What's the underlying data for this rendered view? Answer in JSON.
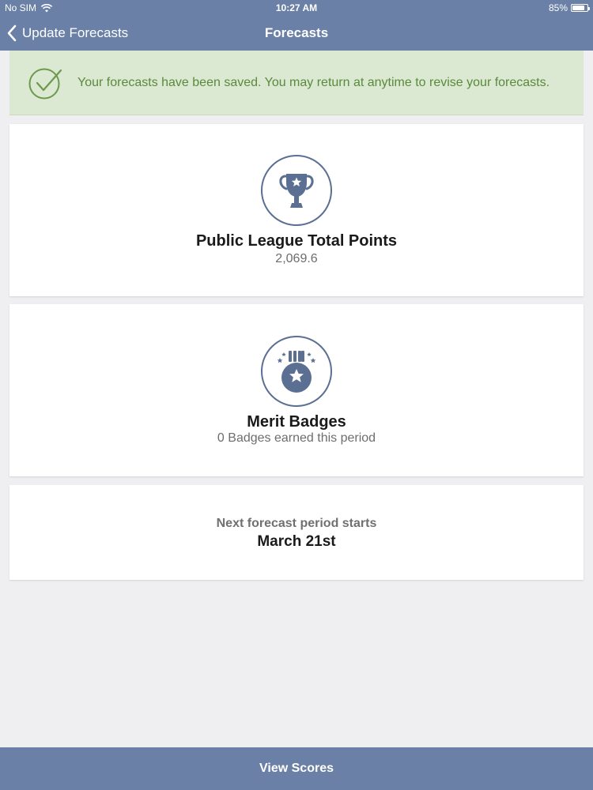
{
  "status_bar": {
    "carrier": "No SIM",
    "time": "10:27 AM",
    "battery": "85%",
    "battery_level": 0.85
  },
  "nav": {
    "back_label": "Update Forecasts",
    "title": "Forecasts"
  },
  "alert": {
    "message": "Your forecasts have been saved. You may return at anytime to revise your forecasts.",
    "icon": "check-circle-icon"
  },
  "points_card": {
    "icon": "trophy-icon",
    "title": "Public League Total Points",
    "value": "2,069.6"
  },
  "badges_card": {
    "icon": "medal-icon",
    "title": "Merit Badges",
    "subtitle": "0 Badges earned this period"
  },
  "next_card": {
    "label": "Next forecast period starts",
    "date": "March 21st"
  },
  "footer": {
    "button_label": "View Scores"
  },
  "colors": {
    "nav_bar": "#6a80a6",
    "success_bg": "#dbe8d2",
    "success_text": "#5a8a3c",
    "icon_blue": "#5b6f93"
  }
}
